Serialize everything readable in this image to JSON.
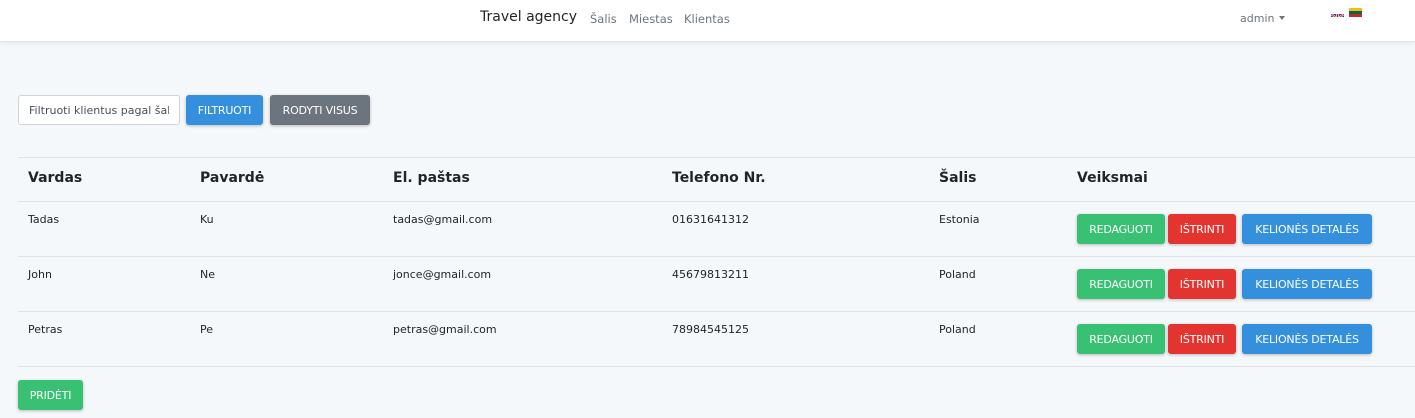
{
  "navbar": {
    "brand": "Travel agency",
    "links": [
      "Šalis",
      "Miestas",
      "Klientas"
    ],
    "user": "admin"
  },
  "filter": {
    "placeholder": "Filtruoti klientus pagal šalį",
    "filter_label": "FILTRUOTI",
    "show_all_label": "RODYTI VISUS"
  },
  "table": {
    "headers": [
      "Vardas",
      "Pavardė",
      "El. paštas",
      "Telefono Nr.",
      "Šalis",
      "Veiksmai"
    ],
    "rows": [
      {
        "first_name": "Tadas",
        "last_name": "Ku",
        "email": "tadas@gmail.com",
        "phone": "01631641312",
        "country": "Estonia"
      },
      {
        "first_name": "John",
        "last_name": "Ne",
        "email": "jonce@gmail.com",
        "phone": "45679813211",
        "country": "Poland"
      },
      {
        "first_name": "Petras",
        "last_name": "Pe",
        "email": "petras@gmail.com",
        "phone": "78984545125",
        "country": "Poland"
      }
    ],
    "actions": {
      "edit_label": "REDAGUOTI",
      "delete_label": "IŠTRINTI",
      "details_label": "KELIONĖS DETALĖS"
    }
  },
  "add_label": "PRIDĖTI",
  "colors": {
    "blue": "#3490dc",
    "gray": "#6c757d",
    "green": "#38c172",
    "red": "#e3342f"
  }
}
